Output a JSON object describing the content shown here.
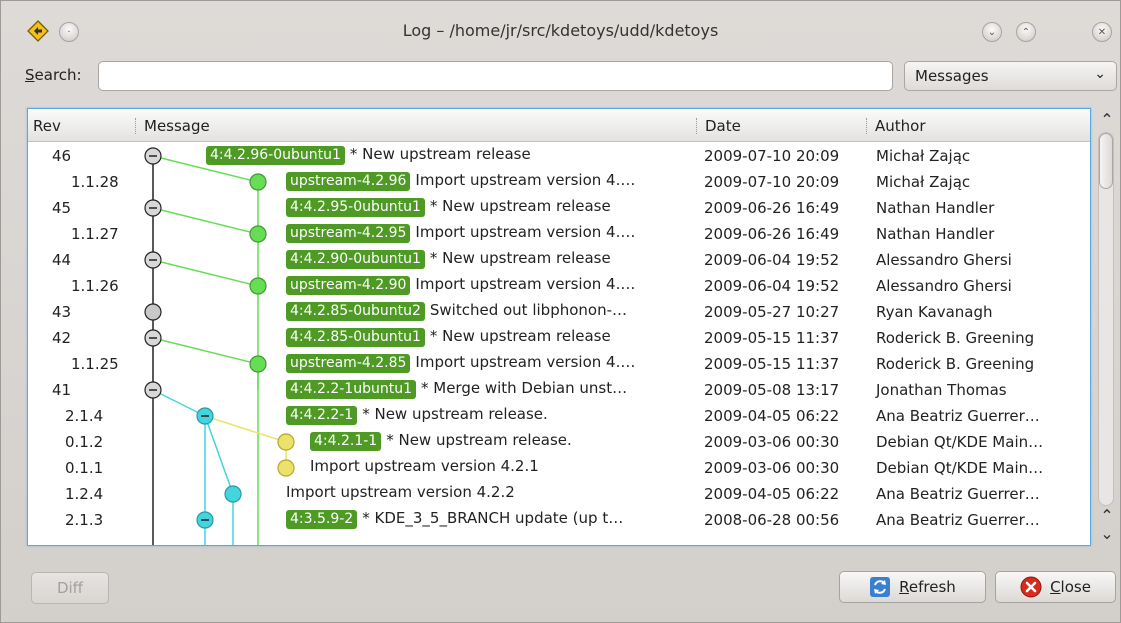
{
  "window": {
    "title": "Log – /home/jr/src/kdetoys/udd/kdetoys"
  },
  "search": {
    "label": "Search:",
    "label_underline": "S",
    "label_rest": "earch:",
    "value": "",
    "scope": "Messages"
  },
  "columns": {
    "rev": "Rev",
    "message": "Message",
    "date": "Date",
    "author": "Author"
  },
  "rows": [
    {
      "rev": "46",
      "tag": "4:4.2.96-0ubuntu1",
      "message": "* New upstream release",
      "date": "2009-07-10 20:09",
      "author": "Michał Zając"
    },
    {
      "rev": "1.1.28",
      "tag": "upstream-4.2.96",
      "message": "Import upstream version 4.…",
      "date": "2009-07-10 20:09",
      "author": "Michał Zając"
    },
    {
      "rev": "45",
      "tag": "4:4.2.95-0ubuntu1",
      "message": "* New upstream release",
      "date": "2009-06-26 16:49",
      "author": "Nathan Handler"
    },
    {
      "rev": "1.1.27",
      "tag": "upstream-4.2.95",
      "message": "Import upstream version 4.…",
      "date": "2009-06-26 16:49",
      "author": "Nathan Handler"
    },
    {
      "rev": "44",
      "tag": "4:4.2.90-0ubuntu1",
      "message": "* New upstream release",
      "date": "2009-06-04 19:52",
      "author": "Alessandro Ghersi"
    },
    {
      "rev": "1.1.26",
      "tag": "upstream-4.2.90",
      "message": "Import upstream version 4.…",
      "date": "2009-06-04 19:52",
      "author": "Alessandro Ghersi"
    },
    {
      "rev": "43",
      "tag": "4:4.2.85-0ubuntu2",
      "message": "Switched out libphonon-…",
      "date": "2009-05-27 10:27",
      "author": "Ryan Kavanagh"
    },
    {
      "rev": "42",
      "tag": "4:4.2.85-0ubuntu1",
      "message": "* New upstream release",
      "date": "2009-05-15 11:37",
      "author": "Roderick B. Greening"
    },
    {
      "rev": "1.1.25",
      "tag": "upstream-4.2.85",
      "message": "Import upstream version 4.…",
      "date": "2009-05-15 11:37",
      "author": "Roderick B. Greening"
    },
    {
      "rev": "41",
      "tag": "4:4.2.2-1ubuntu1",
      "message": "* Merge with Debian unst…",
      "date": "2009-05-08 13:17",
      "author": "Jonathan Thomas"
    },
    {
      "rev": "2.1.4",
      "tag": "4:4.2.2-1",
      "message": "* New upstream release.",
      "date": "2009-04-05 06:22",
      "author": "Ana Beatriz Guerrer…"
    },
    {
      "rev": "0.1.2",
      "tag": "4:4.2.1-1",
      "message": "* New upstream release.",
      "date": "2009-03-06 00:30",
      "author": "Debian Qt/KDE Main…"
    },
    {
      "rev": "0.1.1",
      "tag": "",
      "message": "Import upstream version 4.2.1",
      "date": "2009-03-06 00:30",
      "author": "Debian Qt/KDE Main…"
    },
    {
      "rev": "1.2.4",
      "tag": "",
      "message": "Import upstream version 4.2.2",
      "date": "2009-04-05 06:22",
      "author": "Ana Beatriz Guerrer…"
    },
    {
      "rev": "2.1.3",
      "tag": "4:3.5.9-2",
      "message": "* KDE_3_5_BRANCH update (up t…",
      "date": "2008-06-28 00:56",
      "author": "Ana Beatriz Guerrer…"
    }
  ],
  "more_indicator": "…",
  "buttons": {
    "diff": "Diff",
    "refresh": "Refresh",
    "refresh_underline": "R",
    "refresh_rest": "efresh",
    "close": "Close",
    "close_underline": "C",
    "close_rest": "lose"
  },
  "colors": {
    "tag_bg": "#4e9a25",
    "branch_green": "#66dd55",
    "branch_cyan": "#44d4dd",
    "branch_yellow": "#ece26a",
    "focus": "#5ea7e0"
  }
}
